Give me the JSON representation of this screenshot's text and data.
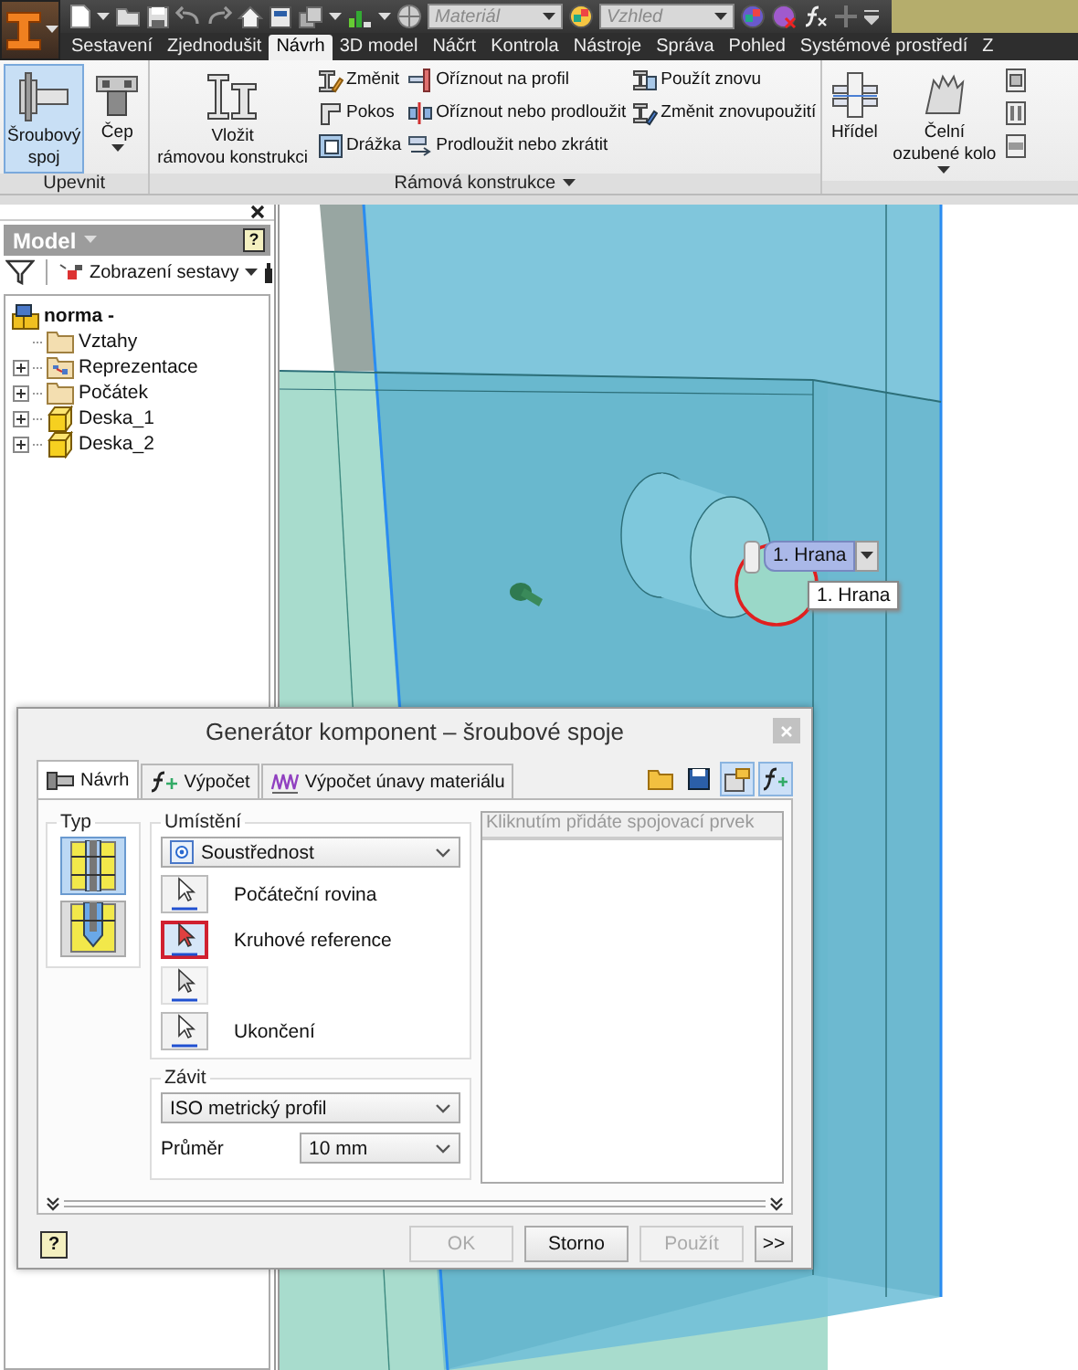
{
  "quick_access": {
    "material": {
      "value": "Materiál"
    },
    "appearance": {
      "value": "Vzhled"
    }
  },
  "ribbon_tabs": [
    {
      "label": "Sestavení",
      "selected": false
    },
    {
      "label": "Zjednodušit",
      "selected": false
    },
    {
      "label": "Návrh",
      "selected": true
    },
    {
      "label": "3D model",
      "selected": false
    },
    {
      "label": "Náčrt",
      "selected": false
    },
    {
      "label": "Kontrola",
      "selected": false
    },
    {
      "label": "Nástroje",
      "selected": false
    },
    {
      "label": "Správa",
      "selected": false
    },
    {
      "label": "Pohled",
      "selected": false
    },
    {
      "label": "Systémové prostředí",
      "selected": false
    },
    {
      "label": "Z",
      "selected": false
    }
  ],
  "ribbon_panels": [
    {
      "title": "Upevnit",
      "menu": false,
      "columns": [
        {
          "kind": "large",
          "lines": [
            "Šroubový",
            "spoj"
          ],
          "active": true,
          "dropdown": false
        },
        {
          "kind": "large",
          "lines": [
            "Čep"
          ],
          "active": false,
          "dropdown": true
        }
      ]
    },
    {
      "title": "Rámová konstrukce",
      "menu": true,
      "columns": [
        {
          "kind": "large",
          "lines": [
            "Vložit",
            "rámovou konstrukci"
          ],
          "active": false,
          "dropdown": false
        },
        {
          "kind": "stack",
          "items": [
            {
              "label": "Změnit"
            },
            {
              "label": "Pokos"
            },
            {
              "label": "Drážka"
            }
          ]
        },
        {
          "kind": "stack",
          "items": [
            {
              "label": "Oříznout na profil"
            },
            {
              "label": "Oříznout nebo prodloužit"
            },
            {
              "label": "Prodloužit nebo zkrátit"
            }
          ]
        },
        {
          "kind": "stack",
          "items": [
            {
              "label": "Použít znovu"
            },
            {
              "label": "Změnit znovupoužití"
            }
          ]
        }
      ]
    },
    {
      "menu": false,
      "columns": [
        {
          "kind": "large",
          "lines": [
            "Hřídel"
          ],
          "active": false,
          "dropdown": false
        },
        {
          "kind": "large",
          "lines": [
            "Čelní",
            "ozubené kolo"
          ],
          "active": false,
          "dropdown": true
        },
        {
          "kind": "icons"
        }
      ]
    }
  ],
  "browser": {
    "title": "Model",
    "help": "?",
    "view": "Zobrazení sestavy",
    "tree": [
      {
        "label": "norma -",
        "kind": "assembly",
        "children": [
          {
            "label": "Vztahy",
            "kind": "folder"
          },
          {
            "label": "Reprezentace",
            "kind": "representation",
            "expanded": false
          },
          {
            "label": "Počátek",
            "kind": "folder",
            "expanded": false
          },
          {
            "label": "Deska_1",
            "kind": "part",
            "expanded": false
          },
          {
            "label": "Deska_2",
            "kind": "part",
            "expanded": false
          }
        ]
      }
    ]
  },
  "viewport": {
    "selector": {
      "value": "1. Hrana"
    },
    "tooltip": "1. Hrana"
  },
  "dialog": {
    "title": "Generátor komponent – šroubové spoje",
    "tabs": [
      {
        "label": "Návrh",
        "selected": true
      },
      {
        "label": "Výpočet",
        "selected": false
      },
      {
        "label": "Výpočet únavy materiálu",
        "selected": false
      }
    ],
    "tools": [
      {
        "selected": false
      },
      {
        "selected": false
      },
      {
        "selected": true
      },
      {
        "selected": true
      }
    ],
    "type_group": {
      "title": "Typ",
      "options": [
        {
          "selected": true
        },
        {
          "selected": false
        }
      ]
    },
    "placement": {
      "title": "Umístění",
      "method": "Soustřednost",
      "selectors": [
        {
          "label": "Počáteční rovina",
          "active": false,
          "disabled": false
        },
        {
          "label": "Kruhové reference",
          "active": true,
          "disabled": false
        },
        {
          "active": false,
          "disabled": true
        },
        {
          "label": "Ukončení",
          "active": false,
          "disabled": false
        }
      ]
    },
    "thread": {
      "title": "Závit",
      "type": "ISO metrický profil",
      "diameter_label": "Průměr",
      "diameter": "10 mm"
    },
    "list": {
      "placeholder": "Kliknutím přidáte spojovací prvek"
    },
    "help": "?",
    "buttons": [
      {
        "label": "OK",
        "disabled": true
      },
      {
        "label": "Storno",
        "disabled": false
      },
      {
        "label": "Použít",
        "disabled": true
      },
      {
        "label": ">>",
        "disabled": false
      }
    ]
  }
}
